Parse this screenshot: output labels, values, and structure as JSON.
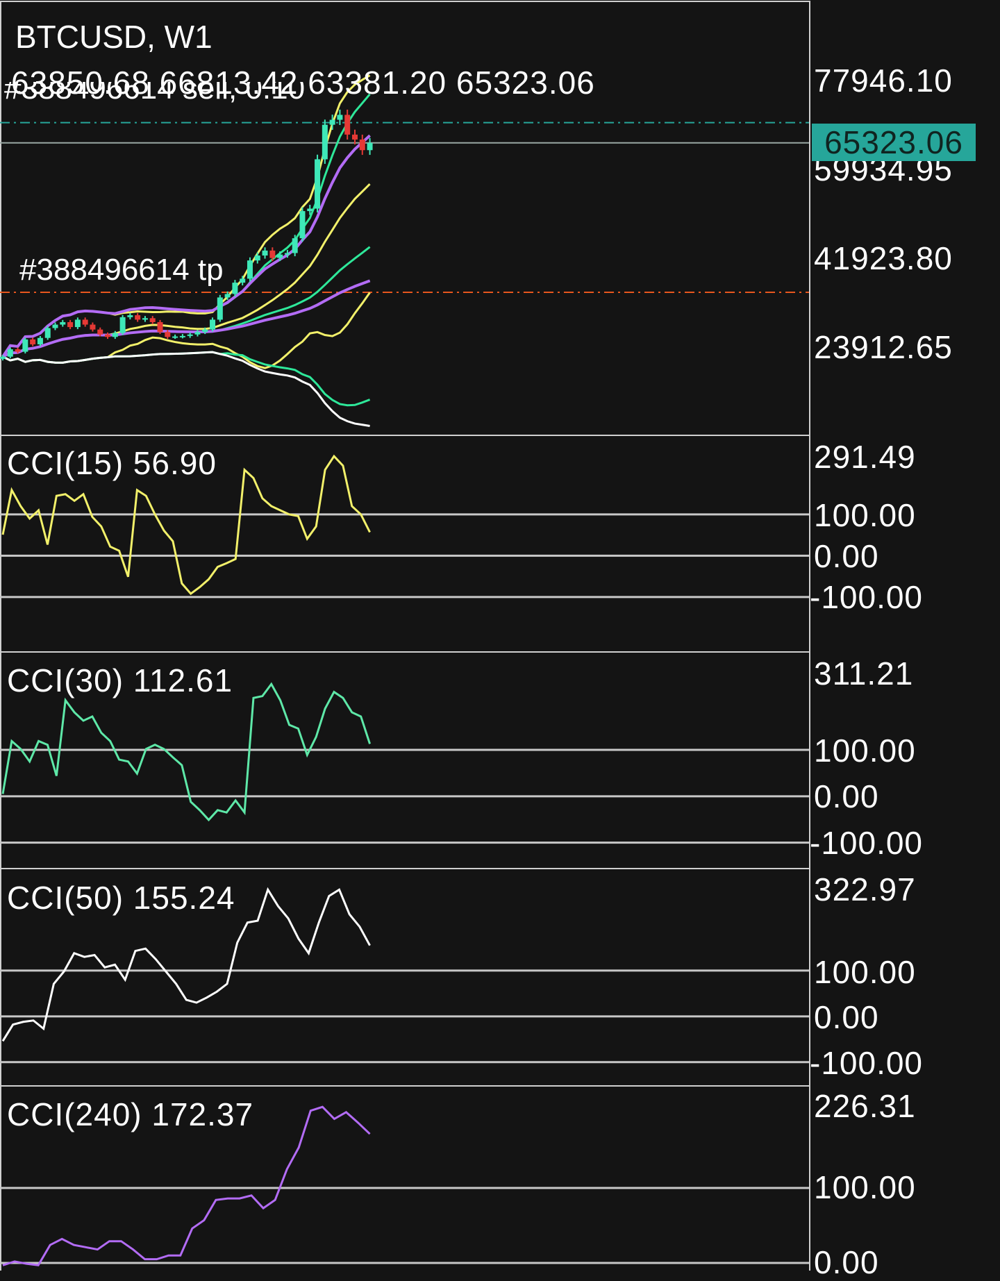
{
  "header": {
    "symbol_timeframe": "BTCUSD, W1",
    "ohlc": "63850.68 66813.42 63381.20 65323.06"
  },
  "trades": {
    "sell_label": "#388496614 sell, 0.10",
    "tp_label": "#388496614 tp",
    "sell_price": 69431,
    "tp_price": 35046,
    "sell_color": "#26a69a",
    "tp_color": "#e8571e"
  },
  "current_price": {
    "value": 65323.06,
    "label": "65323.06",
    "color": "#26a69a"
  },
  "chart_data": [
    {
      "type": "candlestick",
      "title": "BTCUSD, W1",
      "ylim": [
        6063,
        93993
      ],
      "xlim": [
        0,
        108
      ],
      "y_ticks": [
        "77946.10",
        "59934.95",
        "41923.80",
        "23912.65"
      ],
      "y_tick_values": [
        77946.1,
        59934.95,
        41923.8,
        23912.65
      ],
      "closes": [
        22000,
        23500,
        23000,
        25500,
        24500,
        25800,
        27800,
        28500,
        29000,
        28000,
        29500,
        28500,
        27500,
        26500,
        26000,
        26800,
        30000,
        30400,
        29500,
        29800,
        29000,
        27000,
        26000,
        26100,
        26200,
        26500,
        27000,
        27500,
        29500,
        34000,
        34700,
        37000,
        37800,
        41500,
        42500,
        43500,
        42000,
        42700,
        43000,
        46000,
        51500,
        52000,
        62000,
        69000,
        70000,
        71000,
        67000,
        66000,
        63850.68,
        65323.06
      ],
      "bands": [
        {
          "name": "BB(15)",
          "period": 15,
          "color": "#f2f06a"
        },
        {
          "name": "BB(30)",
          "period": 30,
          "color": "#2ee89a"
        },
        {
          "name": "BB(50)",
          "period": 50,
          "color": "#ffffff"
        },
        {
          "name": "MA(240)",
          "period": 240,
          "color": "#b36cf5"
        }
      ],
      "up_color": "#3ee8b8",
      "down_color": "#e53935"
    },
    {
      "type": "line",
      "name": "CCI(15)",
      "label": "CCI(15) 56.90",
      "color": "#f2f06a",
      "ylim": [
        -233,
        291.49
      ],
      "y_ticks": [
        "291.49",
        "100.00",
        "0.00",
        "-100.00"
      ],
      "levels": [
        100,
        0,
        -100
      ],
      "values": [
        51,
        159,
        120,
        90,
        110,
        27,
        145,
        149,
        133,
        149,
        94,
        71,
        22,
        12,
        -51,
        159,
        145,
        100,
        61,
        35,
        -67,
        -92,
        -76,
        -57,
        -27,
        -18,
        -8,
        208,
        188,
        139,
        120,
        110,
        100,
        96,
        41,
        71,
        208,
        241,
        218,
        120,
        100,
        57
      ]
    },
    {
      "type": "line",
      "name": "CCI(30)",
      "label": "CCI(30) 112.61",
      "color": "#5ee8a8",
      "ylim": [
        -156,
        311.21
      ],
      "y_ticks": [
        "311.21",
        "100.00",
        "0.00",
        "-100.00"
      ],
      "levels": [
        100,
        0,
        -100
      ],
      "values": [
        5,
        119,
        102,
        75,
        119,
        111,
        44,
        207,
        181,
        163,
        172,
        137,
        119,
        79,
        75,
        49,
        102,
        111,
        102,
        84,
        67,
        -12,
        -30,
        -51,
        -30,
        -35,
        -9,
        -35,
        212,
        216,
        242,
        207,
        154,
        146,
        89,
        128,
        189,
        225,
        212,
        181,
        172,
        113
      ]
    },
    {
      "type": "line",
      "name": "CCI(50)",
      "label": "CCI(50) 155.24",
      "color": "#ffffff",
      "ylim": [
        -152,
        322.97
      ],
      "y_ticks": [
        "322.97",
        "100.00",
        "0.00",
        "-100.00"
      ],
      "levels": [
        100,
        0,
        -100
      ],
      "values": [
        -54,
        -18,
        -12,
        -9,
        -27,
        71,
        98,
        138,
        130,
        134,
        107,
        113,
        80,
        143,
        148,
        125,
        98,
        71,
        36,
        30,
        41,
        54,
        71,
        161,
        205,
        209,
        277,
        241,
        214,
        170,
        138,
        205,
        263,
        277,
        223,
        196,
        155
      ]
    },
    {
      "type": "line",
      "name": "CCI(240)",
      "label": "CCI(240) 172.37",
      "color": "#b36cf5",
      "ylim": [
        -12,
        236
      ],
      "y_ticks": [
        "226.31",
        "100.00",
        "0.00"
      ],
      "levels": [
        100,
        0
      ],
      "values": [
        -3,
        2,
        -1,
        -3,
        24,
        32,
        24,
        21,
        18,
        29,
        29,
        18,
        5,
        5,
        10,
        10,
        46,
        57,
        84,
        86,
        86,
        90,
        73,
        84,
        125,
        154,
        203,
        208,
        192,
        201,
        187,
        172
      ]
    }
  ]
}
